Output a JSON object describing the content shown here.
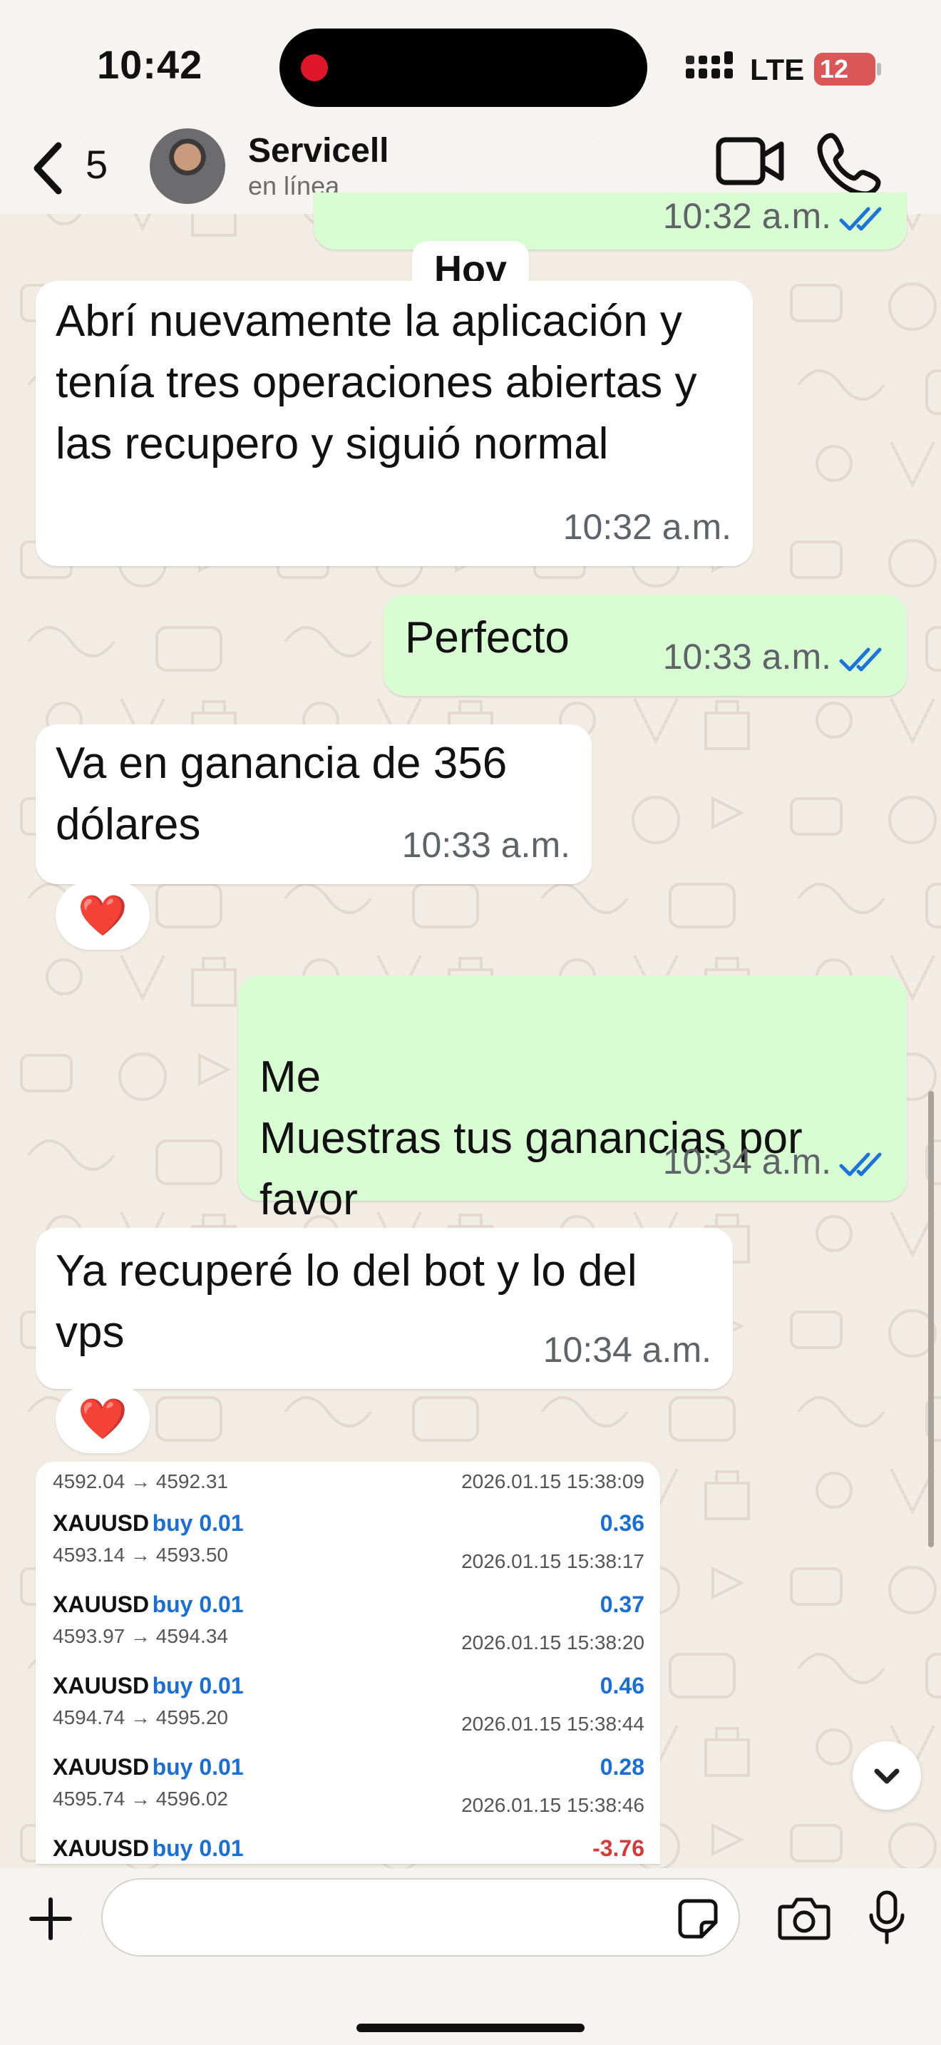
{
  "status_bar": {
    "time": "10:42",
    "network": "LTE",
    "battery": "12"
  },
  "header": {
    "back_count": "5",
    "contact_name": "Servicell",
    "contact_status": "en línea"
  },
  "chat": {
    "prev_time": "10:32 a.m.",
    "date_divider": "Hoy",
    "messages": [
      {
        "direction": "in",
        "text": "Abrí nuevamente la aplicación y tenía tres operaciones abiertas y las recupero y siguió normal",
        "time": "10:32 a.m."
      },
      {
        "direction": "out",
        "text": "Perfecto",
        "time": "10:33 a.m.",
        "read": true
      },
      {
        "direction": "in",
        "text": "Va en ganancia de 356 dólares",
        "time": "10:33 a.m.",
        "reaction": "❤️"
      },
      {
        "direction": "out",
        "text": "Me\nMuestras tus ganancias por favor",
        "time": "10:34 a.m.",
        "read": true
      },
      {
        "direction": "in",
        "text": "Ya recuperé lo del bot y lo del vps",
        "time": "10:34 a.m.",
        "reaction": "❤️"
      }
    ],
    "image_trades": {
      "top_partial": {
        "prices": "4592.04 → 4592.31",
        "date": "2026.01.15 15:38:09"
      },
      "trades": [
        {
          "symbol": "XAUUSD",
          "side": "buy 0.01",
          "profit": "0.36",
          "prices": "4593.14 → 4593.50",
          "date": "2026.01.15 15:38:17"
        },
        {
          "symbol": "XAUUSD",
          "side": "buy 0.01",
          "profit": "0.37",
          "prices": "4593.97 → 4594.34",
          "date": "2026.01.15 15:38:20"
        },
        {
          "symbol": "XAUUSD",
          "side": "buy 0.01",
          "profit": "0.46",
          "prices": "4594.74 → 4595.20",
          "date": "2026.01.15 15:38:44"
        },
        {
          "symbol": "XAUUSD",
          "side": "buy 0.01",
          "profit": "0.28",
          "prices": "4595.74 → 4596.02",
          "date": "2026.01.15 15:38:46"
        },
        {
          "symbol": "XAUUSD",
          "side": "buy 0.01",
          "profit": "-3.76",
          "prices": "",
          "date": ""
        }
      ]
    }
  },
  "composer": {
    "placeholder": ""
  },
  "colors": {
    "incoming_bubble": "#ffffff",
    "outgoing_bubble": "#d9fdd3",
    "read_ticks": "#1d74d8",
    "wallpaper": "#f1ece4",
    "buy_blue": "#1a6fd4",
    "loss_red": "#d33a3a"
  }
}
